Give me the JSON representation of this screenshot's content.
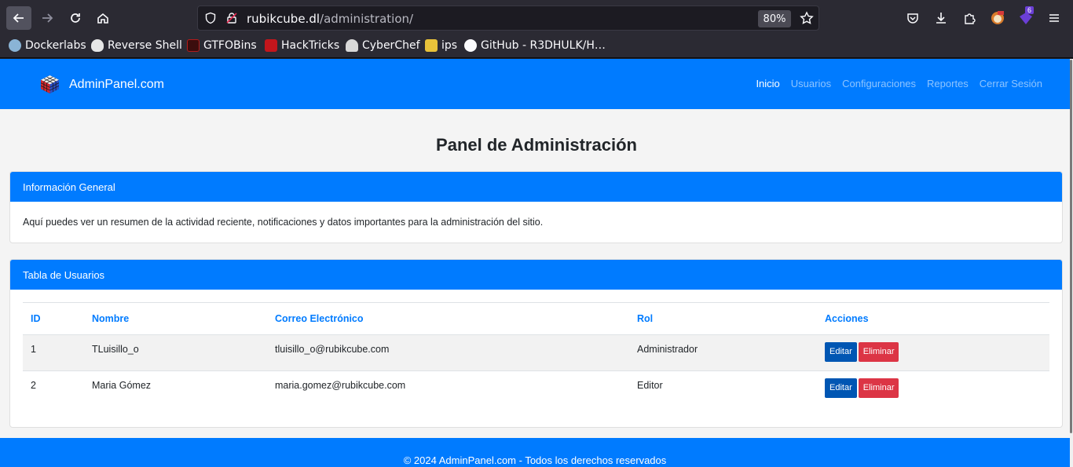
{
  "browser": {
    "url_host": "rubikcube.dl",
    "url_path": "/administration/",
    "zoom": "80%",
    "extension_badge": "6",
    "bookmarks": [
      {
        "label": "Dockerlabs",
        "icon": "docker-icon"
      },
      {
        "label": "Reverse Shell",
        "icon": "skull-icon"
      },
      {
        "label": "GTFOBins",
        "icon": "gtfobins-icon"
      },
      {
        "label": "HackTricks",
        "icon": "hacktricks-icon"
      },
      {
        "label": "CyberChef",
        "icon": "chef-icon"
      },
      {
        "label": "ips",
        "icon": "ips-icon"
      },
      {
        "label": "GitHub - R3DHULK/H…",
        "icon": "github-icon"
      }
    ]
  },
  "navbar": {
    "brand": "AdminPanel.com",
    "links": [
      "Inicio",
      "Usuarios",
      "Configuraciones",
      "Reportes",
      "Cerrar Sesión"
    ]
  },
  "main": {
    "title": "Panel de Administración",
    "info_card": {
      "header": "Información General",
      "body": "Aquí puedes ver un resumen de la actividad reciente, notificaciones y datos importantes para la administración del sitio."
    },
    "users_card": {
      "header": "Tabla de Usuarios",
      "columns": [
        "ID",
        "Nombre",
        "Correo Electrónico",
        "Rol",
        "Acciones"
      ],
      "rows": [
        {
          "id": "1",
          "name": "TLuisillo_o",
          "email": "tluisillo_o@rubikcube.com",
          "role": "Administrador"
        },
        {
          "id": "2",
          "name": "Maria Gómez",
          "email": "maria.gomez@rubikcube.com",
          "role": "Editor"
        }
      ],
      "edit_label": "Editar",
      "delete_label": "Eliminar"
    }
  },
  "footer": {
    "text": "© 2024 AdminPanel.com - Todos los derechos reservados"
  }
}
